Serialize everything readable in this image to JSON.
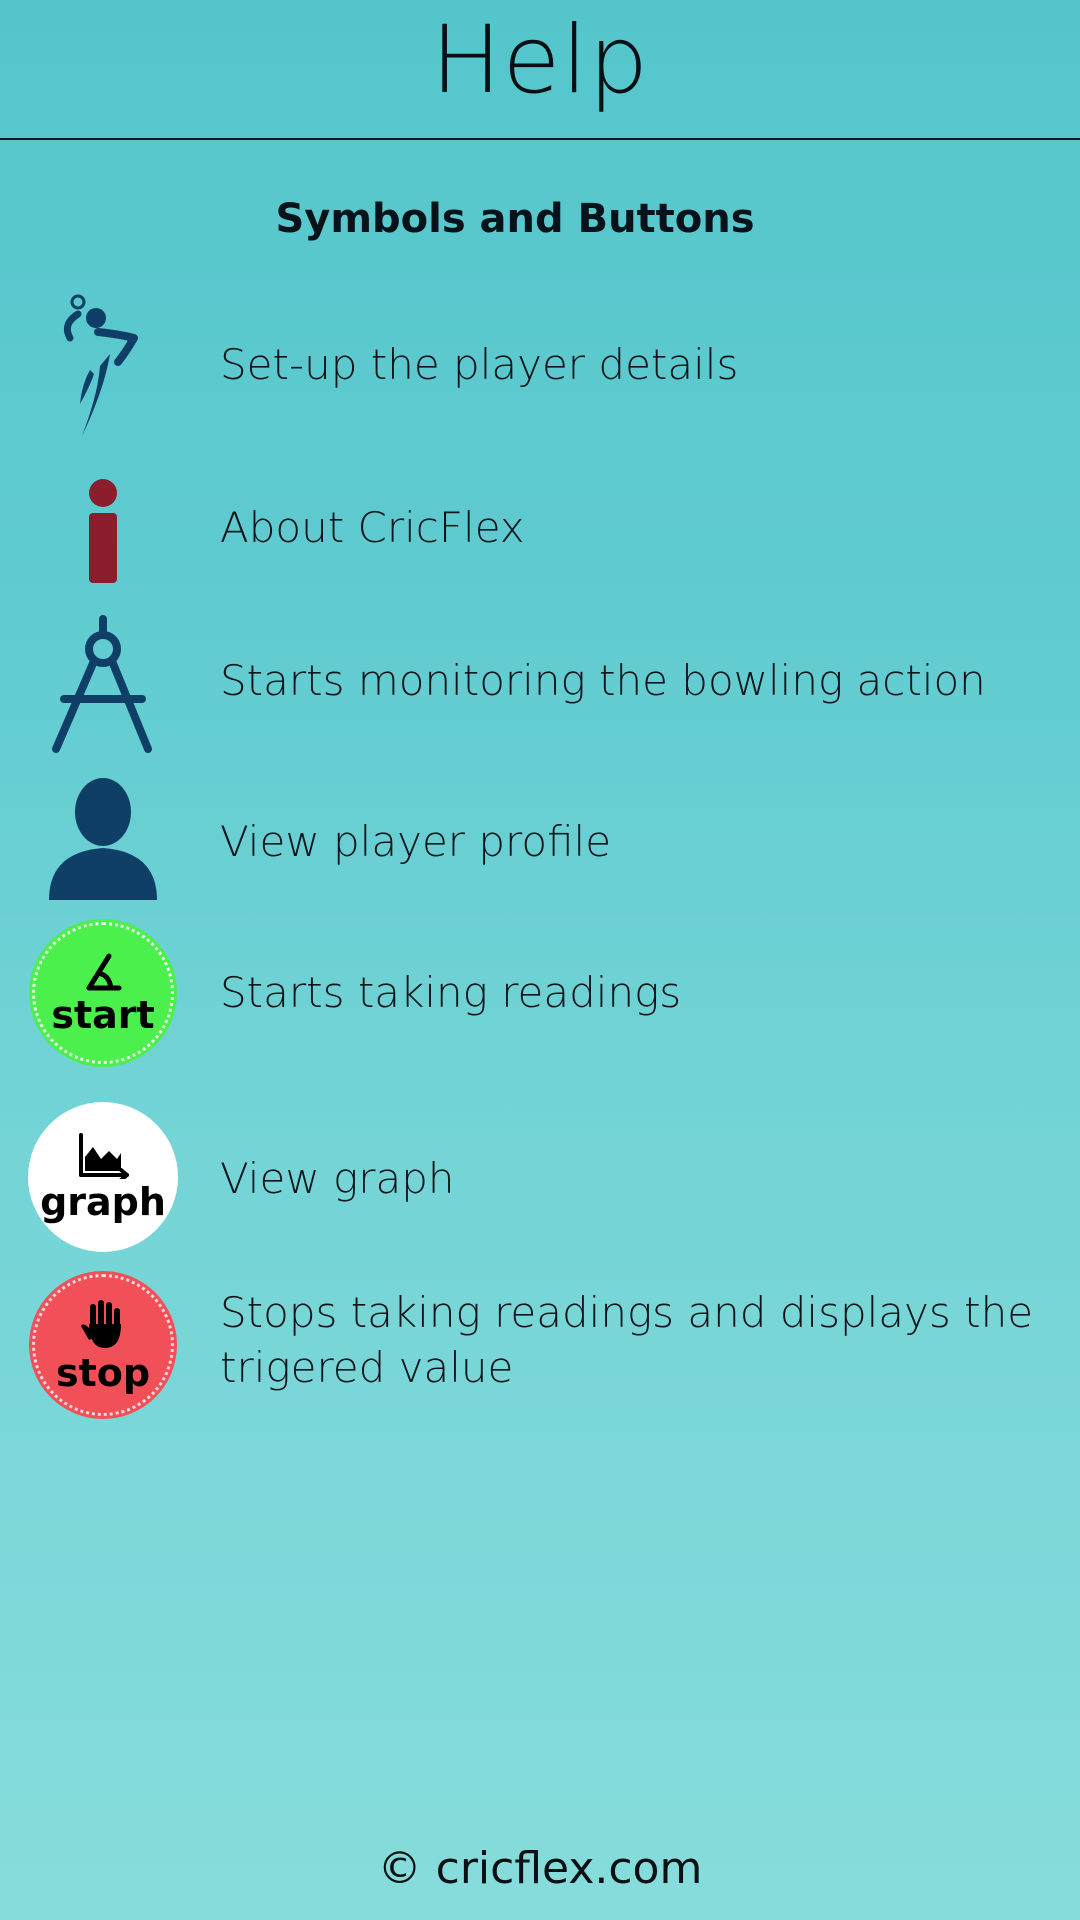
{
  "header": {
    "title": "Help"
  },
  "section": {
    "title": "Symbols and Buttons"
  },
  "items": [
    {
      "icon": "bowler-icon",
      "label": "Set-up the player details"
    },
    {
      "icon": "info-icon",
      "label": "About CricFlex"
    },
    {
      "icon": "compass-icon",
      "label": "Starts monitoring the bowling action"
    },
    {
      "icon": "person-icon",
      "label": "View player profile"
    },
    {
      "icon": "start-icon",
      "label": "Starts taking readings",
      "badge_text": "start"
    },
    {
      "icon": "graph-icon",
      "label": "View graph",
      "badge_text": "graph"
    },
    {
      "icon": "stop-icon",
      "label": "Stops taking readings and displays the trigered value",
      "badge_text": "stop"
    }
  ],
  "colors": {
    "icon_dark": "#0f3f66",
    "info_red": "#8b1e2d",
    "start_green": "#4cf04c",
    "stop_red": "#f25058",
    "graph_white": "#ffffff"
  },
  "footer": {
    "copyright": "© cricflex.com"
  }
}
